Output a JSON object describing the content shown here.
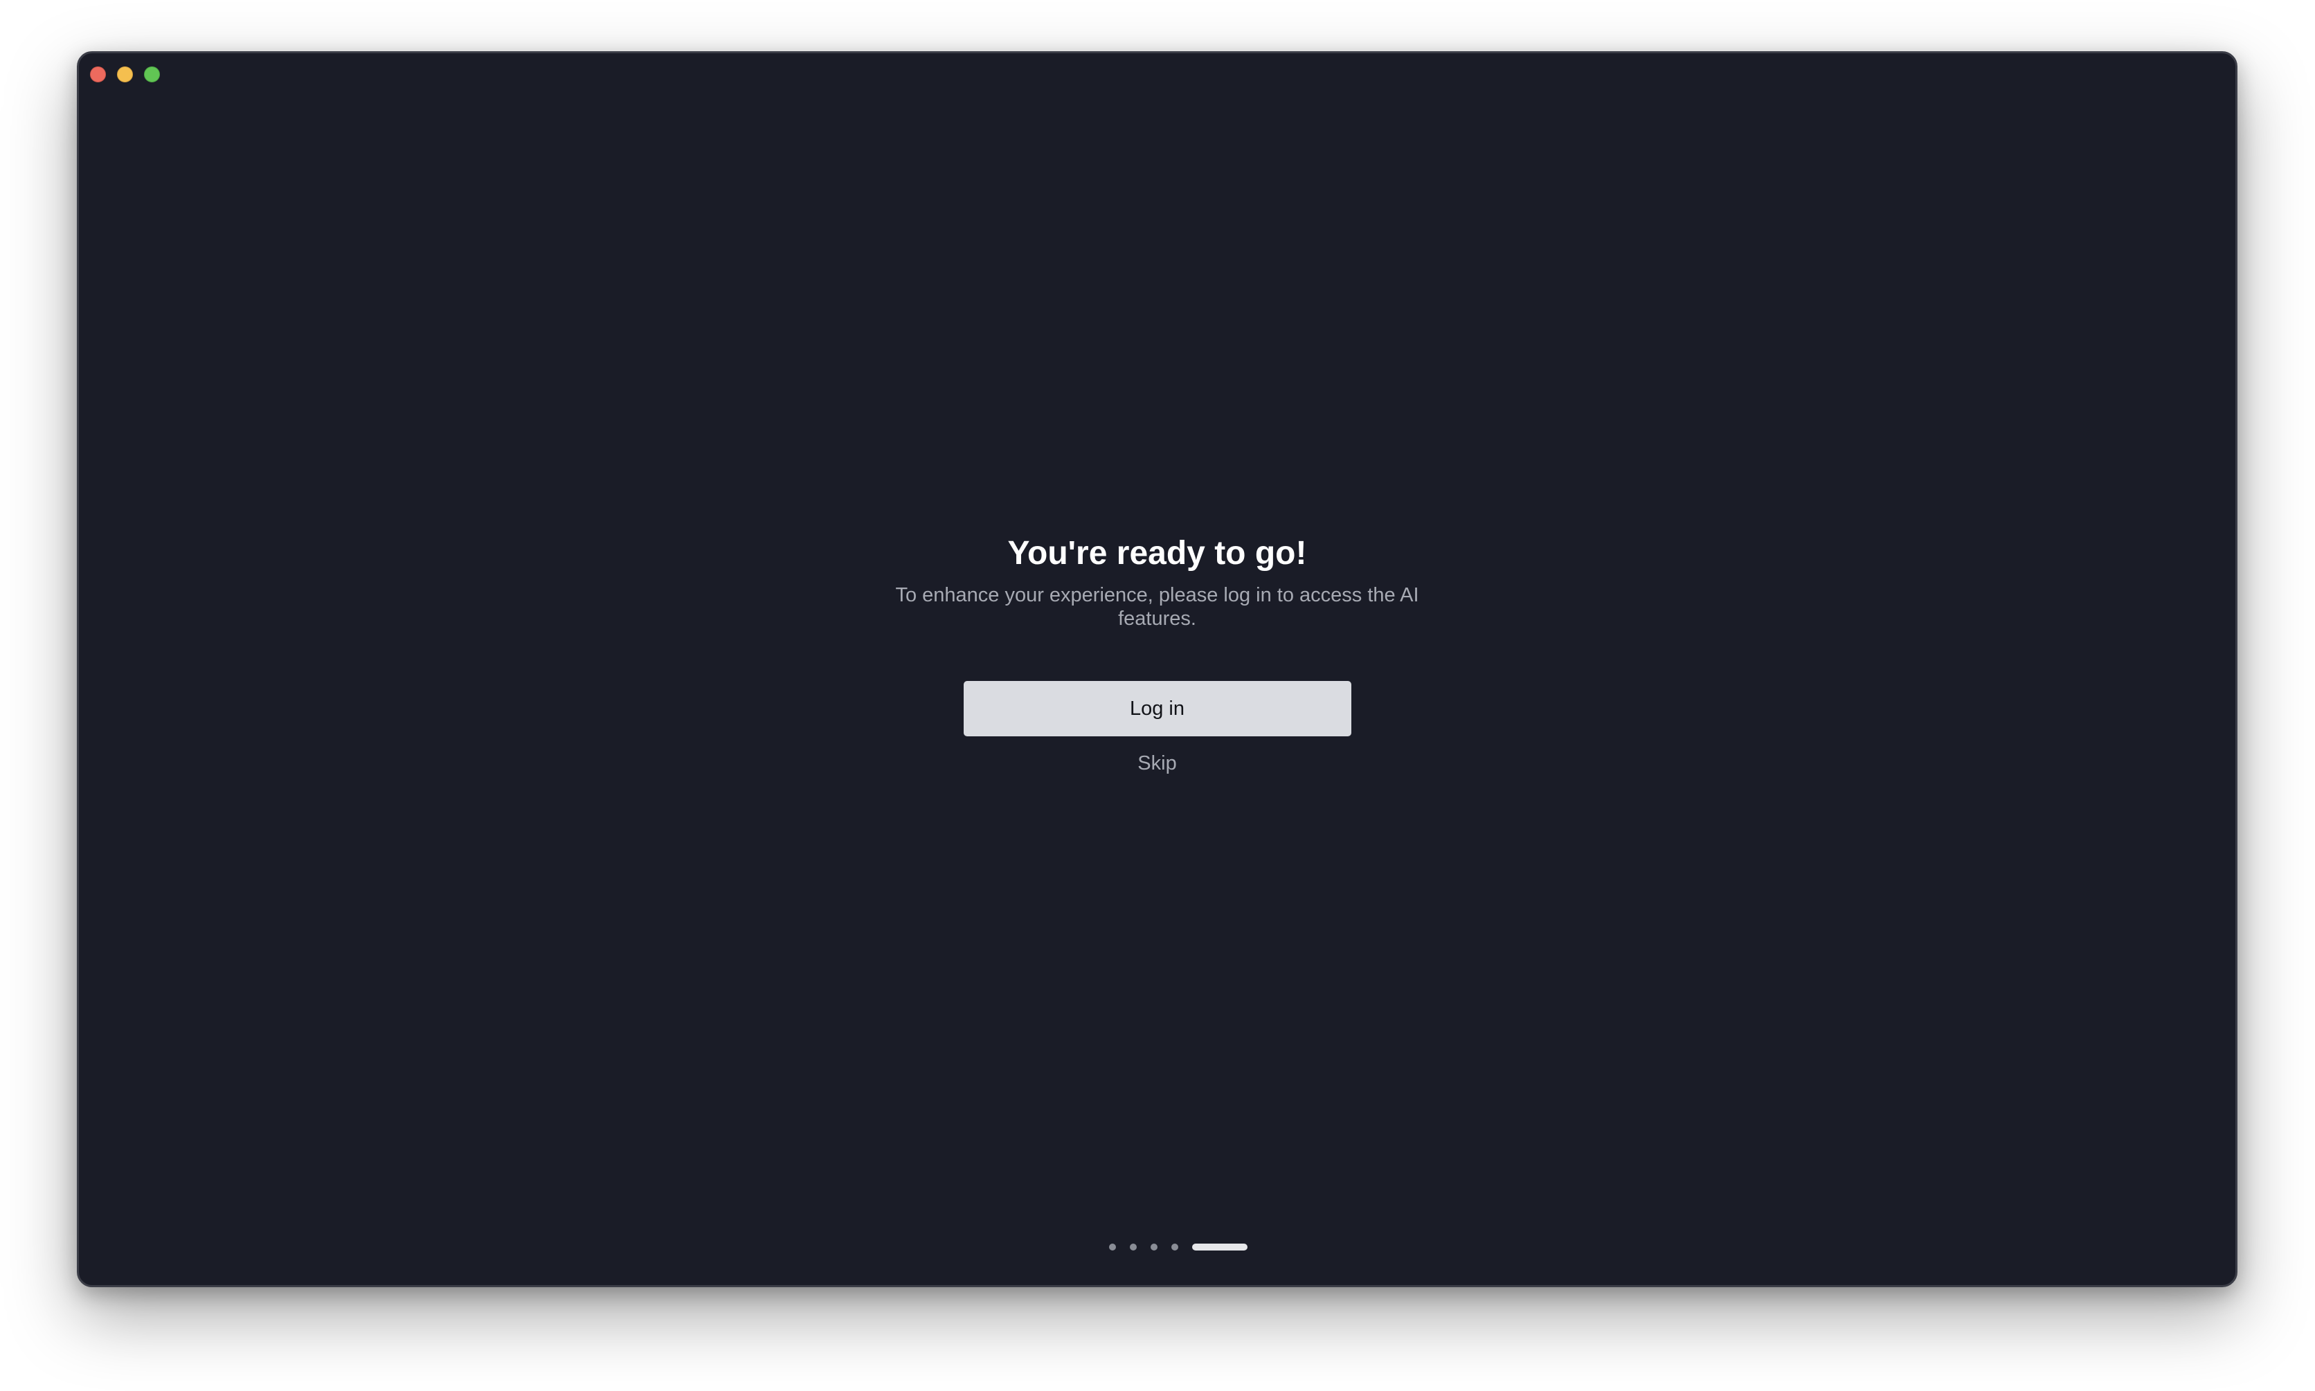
{
  "window": {
    "controls": [
      {
        "name": "close-button",
        "color": "#ed6a5e"
      },
      {
        "name": "minimize-button",
        "color": "#f5bf4f"
      },
      {
        "name": "zoom-button",
        "color": "#61c554"
      }
    ]
  },
  "onboarding": {
    "title": "You're ready to go!",
    "subtitle": "To enhance your experience, please log in to access the AI features.",
    "login_label": "Log in",
    "skip_label": "Skip"
  },
  "pagination": {
    "total_steps": 5,
    "current_step": 5
  },
  "colors": {
    "background": "#1a1c27",
    "button": "#dadce1",
    "muted_text": "#a7aab3"
  }
}
